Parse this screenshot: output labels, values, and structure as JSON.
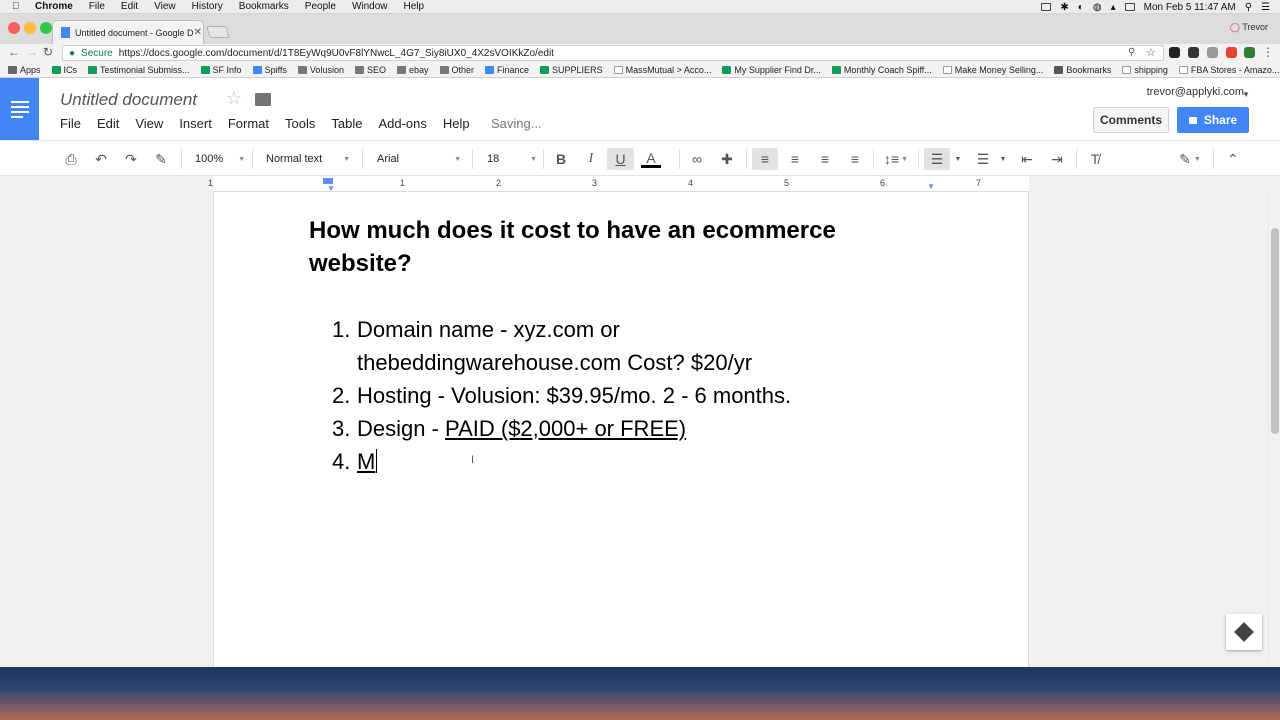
{
  "mac_menubar": {
    "app": "Chrome",
    "items": [
      "File",
      "Edit",
      "View",
      "History",
      "Bookmarks",
      "People",
      "Window",
      "Help"
    ],
    "datetime": "Mon Feb 5  11:47 AM"
  },
  "tab": {
    "title": "Untitled document - Google D",
    "profile": "Trevor"
  },
  "omnibox": {
    "secure_label": "Secure",
    "url": "https://docs.google.com/document/d/1T8EyWq9U0vF8lYNwcL_4G7_Siy8iUX0_4X2sVOIKkZo/edit"
  },
  "bookmarks": [
    {
      "label": "Apps",
      "color": "#666666"
    },
    {
      "label": "ICs",
      "color": "#0f9d58"
    },
    {
      "label": "Testimonial Submiss...",
      "color": "#0f9d58"
    },
    {
      "label": "SF Info",
      "color": "#0f9d58"
    },
    {
      "label": "Spiffs",
      "color": "#4285f4"
    },
    {
      "label": "Volusion",
      "color": "#777777"
    },
    {
      "label": "SEO",
      "color": "#777777"
    },
    {
      "label": "ebay",
      "color": "#777777"
    },
    {
      "label": "Other",
      "color": "#777777"
    },
    {
      "label": "Finance",
      "color": "#4285f4"
    },
    {
      "label": "SUPPLIERS",
      "color": "#0f9d58"
    },
    {
      "label": "MassMutual > Acco...",
      "color": "#ffffff"
    },
    {
      "label": "My Supplier Find Dr...",
      "color": "#0f9d58"
    },
    {
      "label": "Monthly Coach Spiff...",
      "color": "#0f9d58"
    },
    {
      "label": "Make Money Selling...",
      "color": "#ffffff"
    },
    {
      "label": "Bookmarks",
      "color": "#555555"
    },
    {
      "label": "shipping",
      "color": "#ffffff"
    },
    {
      "label": "FBA Stores - Amazo...",
      "color": "#ffffff"
    }
  ],
  "doc": {
    "title": "Untitled document",
    "menu": [
      "File",
      "Edit",
      "View",
      "Insert",
      "Format",
      "Tools",
      "Table",
      "Add-ons",
      "Help"
    ],
    "status": "Saving...",
    "account": "trevor@applyki.com",
    "comments_label": "Comments",
    "share_label": "Share"
  },
  "toolbar": {
    "zoom": "100%",
    "style": "Normal text",
    "font": "Arial",
    "size": "18"
  },
  "ruler_numbers": [
    "1",
    "1",
    "2",
    "3",
    "4",
    "5",
    "6",
    "7"
  ],
  "content": {
    "heading": "How much does it cost to have an ecommerce website?",
    "list": [
      {
        "num": "1.",
        "text": "Domain name - xyz.com or thebeddingwarehouse.com Cost? $20/yr"
      },
      {
        "num": "2.",
        "text": "Hosting - Volusion: $39.95/mo. 2 - 6 months."
      },
      {
        "num": "3.",
        "text_plain": "Design - ",
        "text_underlined": "PAID ($2,000+ or FREE)"
      },
      {
        "num": "4.",
        "text_underlined": "M"
      }
    ]
  },
  "colors": {
    "docs_blue": "#4285f4",
    "secure_green": "#0b8043",
    "text_color_underline": "#000000"
  }
}
